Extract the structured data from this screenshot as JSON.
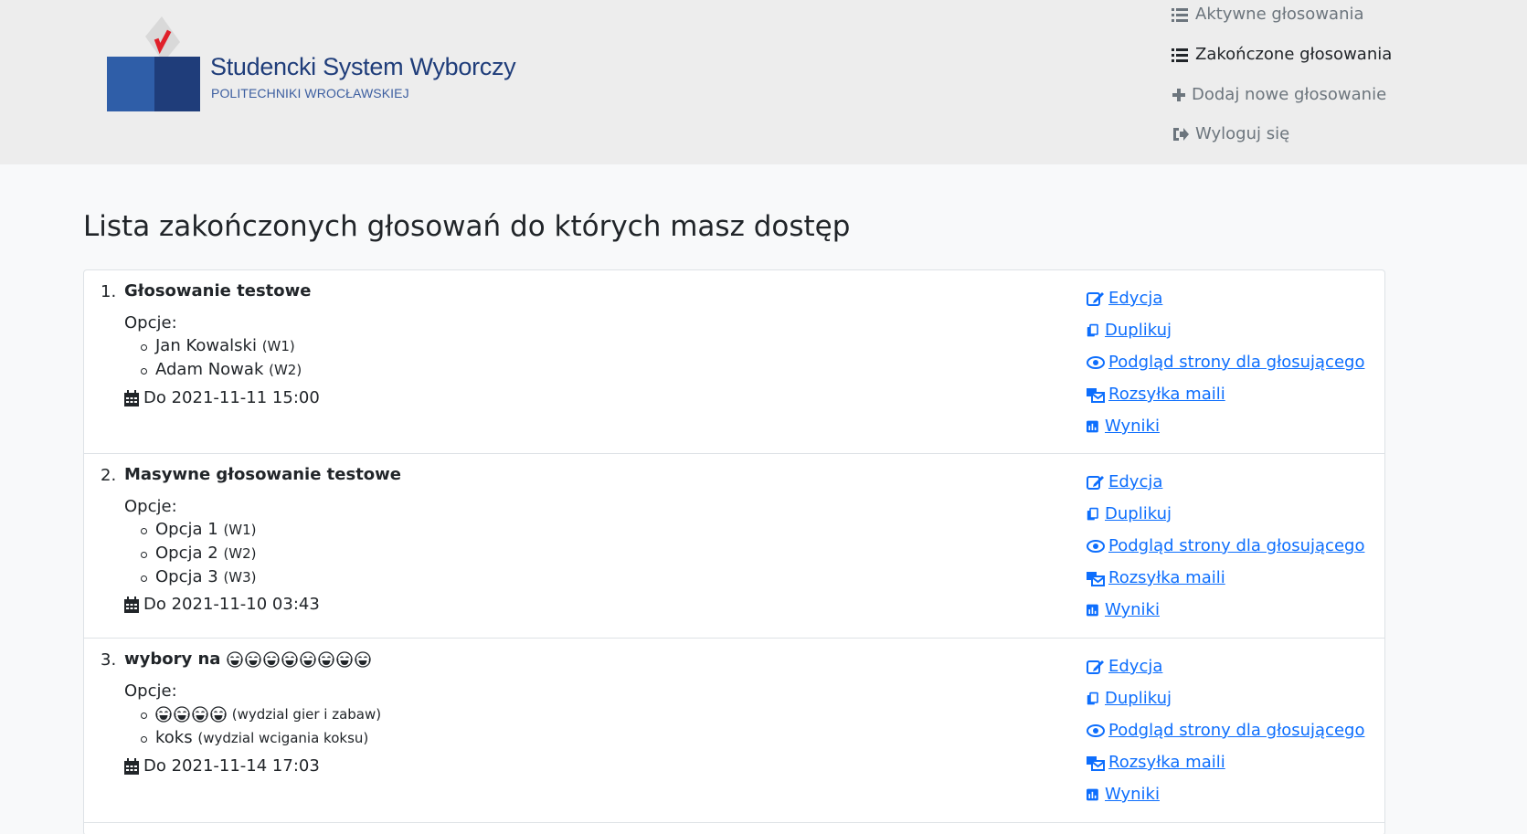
{
  "brand": {
    "title": "Studencki System Wyborczy",
    "subtitle": "POLITECHNIKI WROCŁAWSKIEJ"
  },
  "nav": {
    "items": [
      {
        "label": "Aktywne głosowania",
        "icon": "list-icon",
        "active": false
      },
      {
        "label": "Zakończone głosowania",
        "icon": "list-icon",
        "active": true
      },
      {
        "label": "Dodaj nowe głosowanie",
        "icon": "plus-icon",
        "active": false
      },
      {
        "label": "Wyloguj się",
        "icon": "sign-out-icon",
        "active": false
      }
    ]
  },
  "page": {
    "title": "Lista zakończonych głosowań do których masz dostęp",
    "options_label": "Opcje:"
  },
  "actions": {
    "edit": "Edycja",
    "duplicate": "Duplikuj",
    "preview": "Podgląd strony dla głosującego",
    "mail": "Rozsyłka maili",
    "results": "Wyniki"
  },
  "votings": [
    {
      "num": "1.",
      "title": "Głosowanie testowe",
      "title_emoji_count": 0,
      "options": [
        {
          "name": "Jan Kowalski",
          "tag": "(W1)"
        },
        {
          "name": "Adam Nowak",
          "tag": "(W2)"
        }
      ],
      "deadline": "Do 2021-11-11 15:00"
    },
    {
      "num": "2.",
      "title": "Masywne głosowanie testowe",
      "title_emoji_count": 0,
      "options": [
        {
          "name": "Opcja 1",
          "tag": "(W1)"
        },
        {
          "name": "Opcja 2",
          "tag": "(W2)"
        },
        {
          "name": "Opcja 3",
          "tag": "(W3)"
        }
      ],
      "deadline": "Do 2021-11-10 03:43"
    },
    {
      "num": "3.",
      "title": "wybory na",
      "title_emoji_count": 8,
      "options": [
        {
          "name": "😂😂😂😂",
          "tag": "(wydzial gier i zabaw)"
        },
        {
          "name": "koks",
          "tag": "(wydzial wcigania koksu)"
        }
      ],
      "deadline": "Do 2021-11-14 17:03"
    }
  ],
  "colors": {
    "header_bg": "#ededed",
    "link": "#0d6efd",
    "logo_dark": "#1f3d7a",
    "logo_mid": "#2f5ea8",
    "check_red": "#e0202a"
  }
}
